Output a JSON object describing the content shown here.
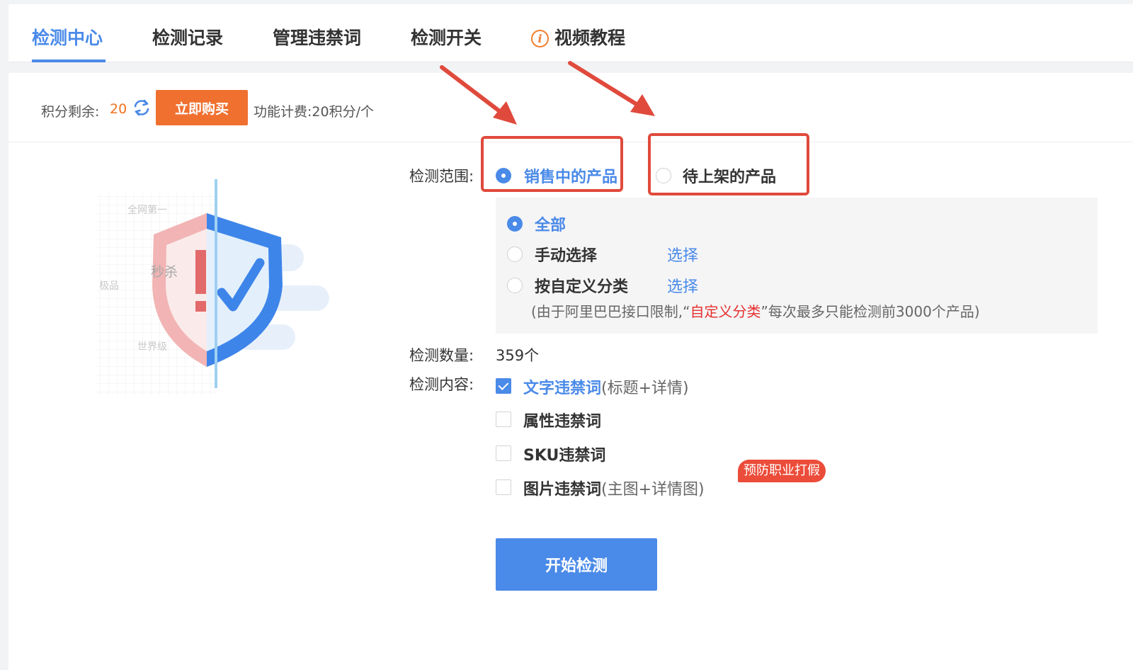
{
  "tabs": [
    {
      "label": "检测中心",
      "active": true
    },
    {
      "label": "检测记录",
      "active": false
    },
    {
      "label": "管理违禁词",
      "active": false
    },
    {
      "label": "检测开关",
      "active": false
    },
    {
      "label": "视频教程",
      "active": false,
      "icon": "info-icon"
    }
  ],
  "points": {
    "label": "积分剩余:",
    "value": "20",
    "refresh_icon": "refresh-icon",
    "buy_label": "立即购买",
    "fee_text": "功能计费:20积分/个"
  },
  "illustration": {
    "labels": [
      "全网第一",
      "秒杀",
      "极品",
      "世界级"
    ]
  },
  "form": {
    "scope_label": "检测范围:",
    "scope_options": [
      {
        "label": "销售中的产品",
        "selected": true
      },
      {
        "label": "待上架的产品",
        "selected": false
      }
    ],
    "product_options": [
      {
        "label": "全部",
        "selected": true
      },
      {
        "label": "手动选择",
        "selected": false,
        "link": "选择"
      },
      {
        "label": "按自定义分类",
        "selected": false,
        "link": "选择"
      }
    ],
    "note_prefix": "(由于阿里巴巴接口限制,“",
    "note_highlight": "自定义分类",
    "note_suffix": "”每次最多只能检测前3000个产品)",
    "count_label": "检测数量:",
    "count_value": "359个",
    "content_label": "检测内容:",
    "content_options": [
      {
        "label": "文字违禁词",
        "sub": "(标题+详情)",
        "checked": true
      },
      {
        "label": "属性违禁词",
        "sub": "",
        "checked": false
      },
      {
        "label": "SKU违禁词",
        "sub": "",
        "checked": false
      },
      {
        "label": "图片违禁词",
        "sub": "(主图+详情图)",
        "checked": false
      }
    ],
    "badge": "预防职业打假",
    "start_label": "开始检测"
  },
  "colors": {
    "accent": "#4a8ae8",
    "buy_button": "#f07030",
    "annotation_red": "#e04a3c",
    "badge_red": "#ec4c3a"
  }
}
